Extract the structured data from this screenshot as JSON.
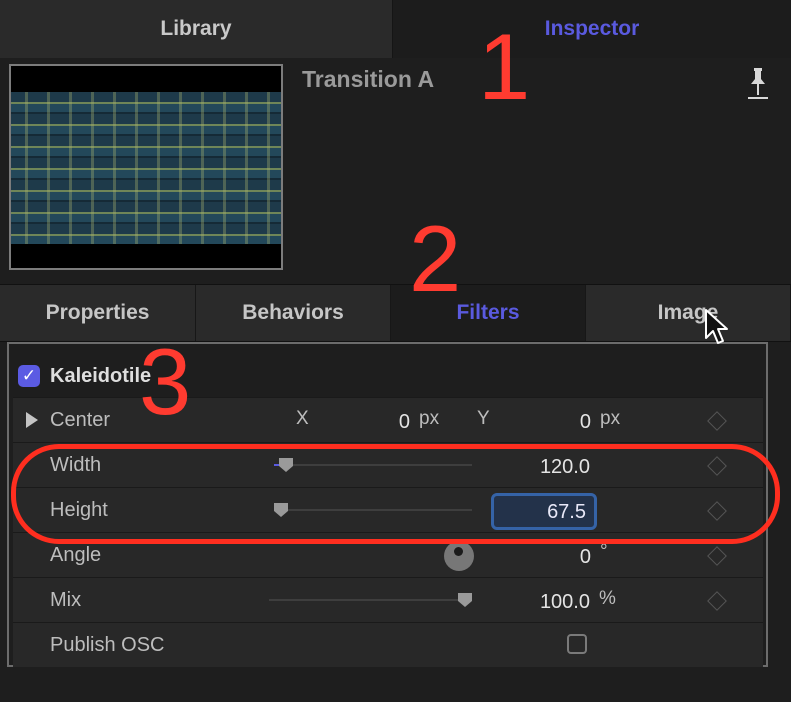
{
  "top_tabs": [
    {
      "label": "Library",
      "selected": false
    },
    {
      "label": "Inspector",
      "selected": true
    }
  ],
  "header": {
    "clip_title": "Transition A",
    "pin_icon": "pin-icon"
  },
  "sub_tabs": [
    {
      "label": "Properties",
      "selected": false
    },
    {
      "label": "Behaviors",
      "selected": false
    },
    {
      "label": "Filters",
      "selected": true
    },
    {
      "label": "Image",
      "selected": false
    }
  ],
  "filter": {
    "name": "Kaleidotile",
    "enabled": true,
    "params": {
      "center": {
        "label": "Center",
        "x_label": "X",
        "x_value": "0",
        "x_unit": "px",
        "y_label": "Y",
        "y_value": "0",
        "y_unit": "px"
      },
      "width": {
        "label": "Width",
        "value": "120.0",
        "slider_fraction": 0.05
      },
      "height": {
        "label": "Height",
        "value": "67.5",
        "slider_fraction": 0.02
      },
      "angle": {
        "label": "Angle",
        "value": "0",
        "unit": "°"
      },
      "mix": {
        "label": "Mix",
        "value": "100.0",
        "unit": "%",
        "slider_fraction": 1.0
      },
      "publish_osc": {
        "label": "Publish OSC",
        "checked": false
      }
    }
  },
  "annotations": [
    "1",
    "2",
    "3"
  ],
  "colors": {
    "accent": "#5a5adf",
    "annotation": "#ff3b30",
    "background": "#1e1e1e"
  }
}
